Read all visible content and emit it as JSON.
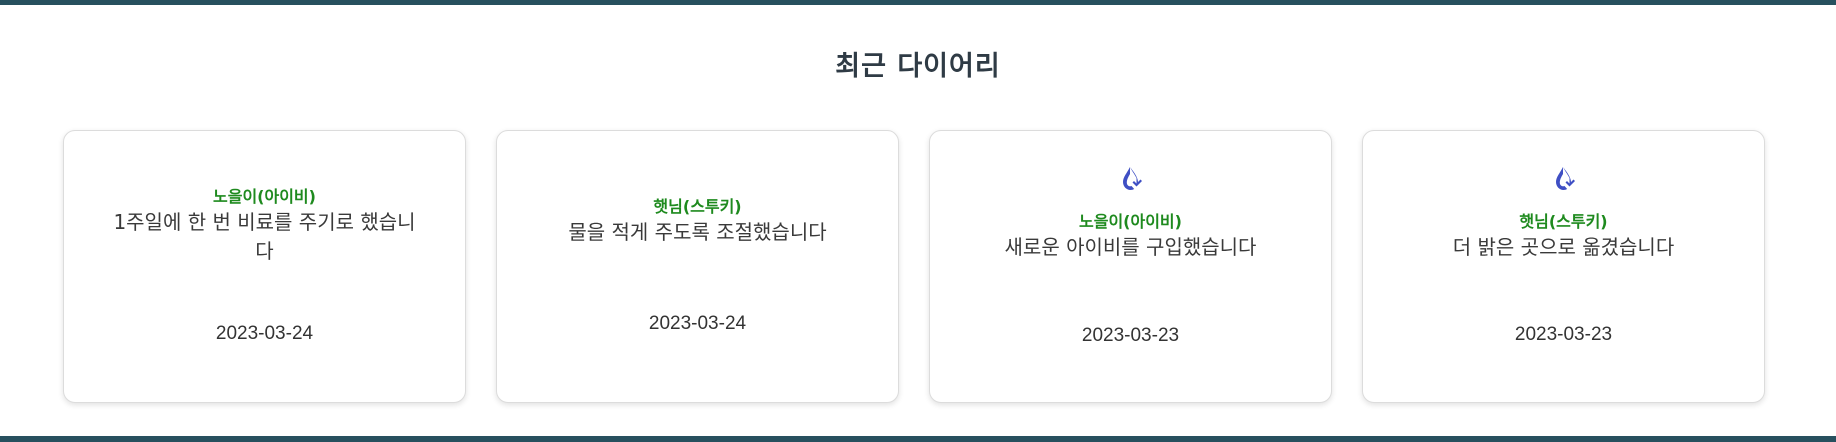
{
  "section": {
    "title": "최근 다이어리"
  },
  "cards": [
    {
      "plant": "노을이(아이비)",
      "text": "1주일에 한 번 비료를 주기로 했습니다",
      "date": "2023-03-24",
      "icon": "water-drop-icon",
      "has_icon": false
    },
    {
      "plant": "햇님(스투키)",
      "text": "물을 적게 주도록 조절했습니다",
      "date": "2023-03-24",
      "icon": "water-drop-icon",
      "has_icon": false
    },
    {
      "plant": "노을이(아이비)",
      "text": "새로운 아이비를 구입했습니다",
      "date": "2023-03-23",
      "icon": "water-drop-icon",
      "has_icon": true
    },
    {
      "plant": "햇님(스투키)",
      "text": "더 밝은 곳으로 옮겼습니다",
      "date": "2023-03-23",
      "icon": "water-drop-icon",
      "has_icon": true
    }
  ],
  "colors": {
    "border_bar": "#27505e",
    "plant_name": "#1e8a1e",
    "icon": "#3f4fc4"
  }
}
